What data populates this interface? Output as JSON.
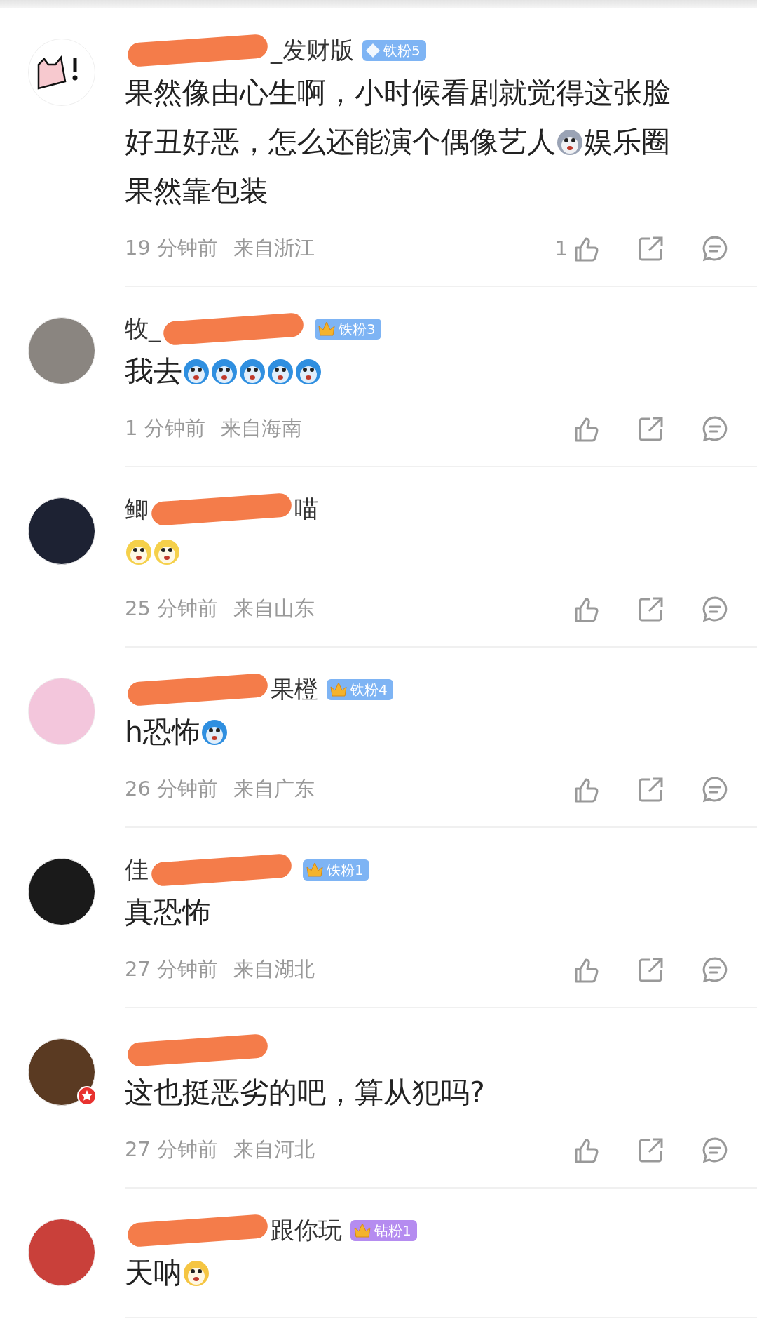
{
  "comments": [
    {
      "avatar": {
        "kind": "drawing",
        "color": "#f7c9cf"
      },
      "verified": false,
      "name": {
        "after": "_发财版"
      },
      "badge": {
        "kind": "diamond",
        "label": "铁粉5",
        "color": "#7eb4f4"
      },
      "body": [
        {
          "kind": "text",
          "text": "果然像由心生啊，小时候看剧就觉得这张脸"
        },
        {
          "kind": "text",
          "text": "好丑好恶，怎么还能演个偶像艺人"
        },
        {
          "kind": "emoji",
          "color": "#9aa3b5"
        },
        {
          "kind": "text",
          "text": "娱乐圈"
        },
        {
          "kind": "text",
          "text": "果然靠包装"
        }
      ],
      "time": "19 分钟前",
      "location": "来自浙江",
      "likes": "1"
    },
    {
      "avatar": {
        "kind": "photo",
        "color": "#8a8580"
      },
      "verified": false,
      "name": {
        "before": "牧_"
      },
      "badge": {
        "kind": "crown",
        "label": "铁粉3",
        "color": "#7eb4f4"
      },
      "body": [
        {
          "kind": "text",
          "text": "我去"
        },
        {
          "kind": "emoji",
          "color": "#2f8fe0"
        },
        {
          "kind": "emoji",
          "color": "#2f8fe0"
        },
        {
          "kind": "emoji",
          "color": "#2f8fe0"
        },
        {
          "kind": "emoji",
          "color": "#2f8fe0"
        },
        {
          "kind": "emoji",
          "color": "#2f8fe0"
        }
      ],
      "time": "1 分钟前",
      "location": "来自海南"
    },
    {
      "avatar": {
        "kind": "photo",
        "color": "#1d2233"
      },
      "verified": false,
      "name": {
        "before": "鲫",
        "after": "喵"
      },
      "body": [
        {
          "kind": "emoji",
          "color": "#f5d04a"
        },
        {
          "kind": "emoji",
          "color": "#f5d04a"
        }
      ],
      "time": "25 分钟前",
      "location": "来自山东"
    },
    {
      "avatar": {
        "kind": "photo",
        "color": "#f3c6dc"
      },
      "verified": false,
      "name": {
        "after": "果橙"
      },
      "badge": {
        "kind": "crown",
        "label": "铁粉4",
        "color": "#7eb4f4"
      },
      "body": [
        {
          "kind": "text",
          "text": "h恐怖"
        },
        {
          "kind": "emoji",
          "color": "#2f8fe0"
        }
      ],
      "time": "26 分钟前",
      "location": "来自广东"
    },
    {
      "avatar": {
        "kind": "photo",
        "color": "#1a1a1a"
      },
      "verified": false,
      "name": {
        "before": "佳"
      },
      "badge": {
        "kind": "crown",
        "label": "铁粉1",
        "color": "#7eb4f4"
      },
      "body": [
        {
          "kind": "text",
          "text": "真恐怖"
        }
      ],
      "time": "27 分钟前",
      "location": "来自湖北"
    },
    {
      "avatar": {
        "kind": "photo",
        "color": "#5a3a22"
      },
      "verified": true,
      "body": [
        {
          "kind": "text",
          "text": "这也挺恶劣的吧，算从犯吗?"
        }
      ],
      "time": "27 分钟前",
      "location": "来自河北"
    },
    {
      "avatar": {
        "kind": "photo",
        "color": "#c9403a"
      },
      "verified": false,
      "name": {
        "after": "跟你玩"
      },
      "badge": {
        "kind": "crown",
        "label": "钻粉1",
        "color": "#b58cf0"
      },
      "body": [
        {
          "kind": "text",
          "text": "天呐"
        },
        {
          "kind": "emoji",
          "color": "#f5c542"
        }
      ]
    }
  ]
}
